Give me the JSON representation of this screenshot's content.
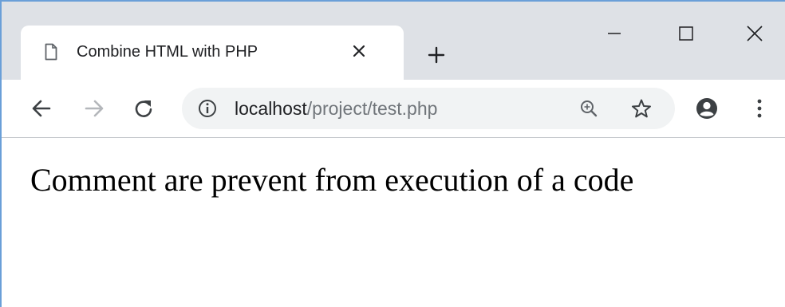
{
  "tab": {
    "title": "Combine HTML with PHP",
    "page_icon": "document-icon",
    "close_icon": "close-icon"
  },
  "new_tab_icon": "plus-icon",
  "window_controls": {
    "minimize_icon": "minimize-icon",
    "maximize_icon": "maximize-icon",
    "close_icon": "close-icon"
  },
  "toolbar": {
    "back_icon": "arrow-left-icon",
    "forward_icon": "arrow-right-icon",
    "reload_icon": "reload-icon",
    "zoom_icon": "zoom-in-icon",
    "bookmark_icon": "star-icon",
    "account_icon": "account-icon",
    "menu_icon": "kebab-menu-icon"
  },
  "address_bar": {
    "site_info_icon": "info-icon",
    "host": "localhost",
    "path": "/project/test.php"
  },
  "page": {
    "text": "Comment are prevent from execution of a code"
  },
  "colors": {
    "tabstrip_bg": "#dee1e6",
    "omnibox_bg": "#f1f3f4",
    "url_path": "#70757a",
    "window_border": "#6a9fd8"
  }
}
